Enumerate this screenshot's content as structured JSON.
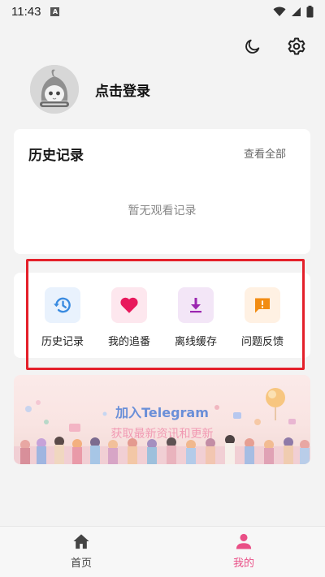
{
  "status": {
    "time": "11:43",
    "notif_letter": "A"
  },
  "header": {
    "login_label": "点击登录"
  },
  "history": {
    "title": "历史记录",
    "view_all": "查看全部",
    "empty_text": "暂无观看记录"
  },
  "quick_actions": [
    {
      "label": "历史记录",
      "icon": "history-icon",
      "bg": "#e9f2fd",
      "color": "#3a8be0"
    },
    {
      "label": "我的追番",
      "icon": "heart-icon",
      "bg": "#fde7ee",
      "color": "#e8195c"
    },
    {
      "label": "离线缓存",
      "icon": "download-icon",
      "bg": "#f3e6f7",
      "color": "#9b27b0"
    },
    {
      "label": "问题反馈",
      "icon": "feedback-icon",
      "bg": "#fff1e3",
      "color": "#f28c12"
    }
  ],
  "banner": {
    "title": "加入Telegram",
    "subtitle": "获取最新资讯和更新"
  },
  "bottom_nav": [
    {
      "label": "首页",
      "icon": "home-icon",
      "active": false
    },
    {
      "label": "我的",
      "icon": "person-icon",
      "active": true
    }
  ],
  "colors": {
    "accent": "#e94f86",
    "highlight_border": "#e4202a",
    "nav_inactive": "#444444"
  }
}
